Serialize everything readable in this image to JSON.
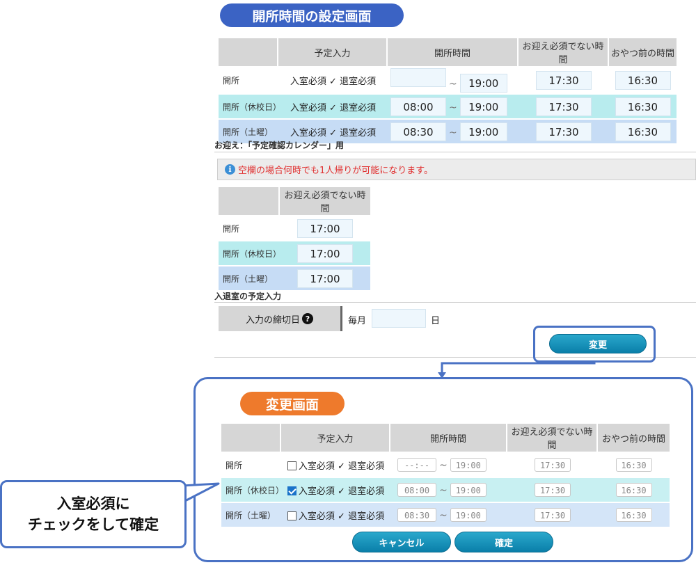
{
  "settings": {
    "title": "開所時間の設定画面",
    "headers": [
      "予定入力",
      "開所時間",
      "お迎え必須でない時間",
      "おやつ前の時間"
    ],
    "rows": [
      {
        "label": "開所",
        "entry_req": "入室必須",
        "check": "✓",
        "exit_req": "退室必須",
        "open_from": "",
        "tilde": "~",
        "open_to": "19:00",
        "pickup": "17:30",
        "snack": "16:30"
      },
      {
        "label": "開所（休校日）",
        "entry_req": "入室必須",
        "check": "✓",
        "exit_req": "退室必須",
        "open_from": "08:00",
        "tilde": "~",
        "open_to": "19:00",
        "pickup": "17:30",
        "snack": "16:30"
      },
      {
        "label": "開所（土曜）",
        "entry_req": "入室必須",
        "check": "✓",
        "exit_req": "退室必須",
        "open_from": "08:30",
        "tilde": "~",
        "open_to": "19:00",
        "pickup": "17:30",
        "snack": "16:30"
      }
    ],
    "pickup_section_label": "お迎え：「予定確認カレンダー」用",
    "info_icon": "i",
    "info_text": "空欄の場合何時でも1人帰りが可能になります。",
    "pickup_header": "お迎え必須でない時間",
    "pickup_rows": [
      {
        "label": "開所",
        "value": "17:00"
      },
      {
        "label": "開所（休校日）",
        "value": "17:00"
      },
      {
        "label": "開所（土曜）",
        "value": "17:00"
      }
    ],
    "entry_section_label": "入退室の予定入力",
    "deadline_label": "入力の締切日",
    "deadline_help": "?",
    "deadline_prefix": "毎月",
    "deadline_value": "",
    "deadline_suffix": "日",
    "change_button": "変更"
  },
  "edit": {
    "title": "変更画面",
    "headers": [
      "予定入力",
      "開所時間",
      "お迎え必須でない時間",
      "おやつ前の時間"
    ],
    "rows": [
      {
        "label": "開所",
        "entry_checked": false,
        "entry_req": "入室必須",
        "check": "✓",
        "exit_req": "退室必須",
        "open_from": "--:--",
        "tilde": "~",
        "open_to": "19:00",
        "pickup": "17:30",
        "snack": "16:30"
      },
      {
        "label": "開所（休校日）",
        "entry_checked": true,
        "entry_req": "入室必須",
        "check": "✓",
        "exit_req": "退室必須",
        "open_from": "08:00",
        "tilde": "~",
        "open_to": "19:00",
        "pickup": "17:30",
        "snack": "16:30"
      },
      {
        "label": "開所（土曜）",
        "entry_checked": false,
        "entry_req": "入室必須",
        "check": "✓",
        "exit_req": "退室必須",
        "open_from": "08:30",
        "tilde": "~",
        "open_to": "19:00",
        "pickup": "17:30",
        "snack": "16:30"
      }
    ],
    "cancel_button": "キャンセル",
    "confirm_button": "確定"
  },
  "callout": {
    "line1": "入室必須に",
    "line2": "チェックをして確定"
  },
  "colors": {
    "title_blue": "#3b63c4",
    "title_orange": "#ee7a2c",
    "button_teal": "#0a7fa9",
    "frame_blue": "#4a72c4",
    "notice_red": "#e03030"
  }
}
